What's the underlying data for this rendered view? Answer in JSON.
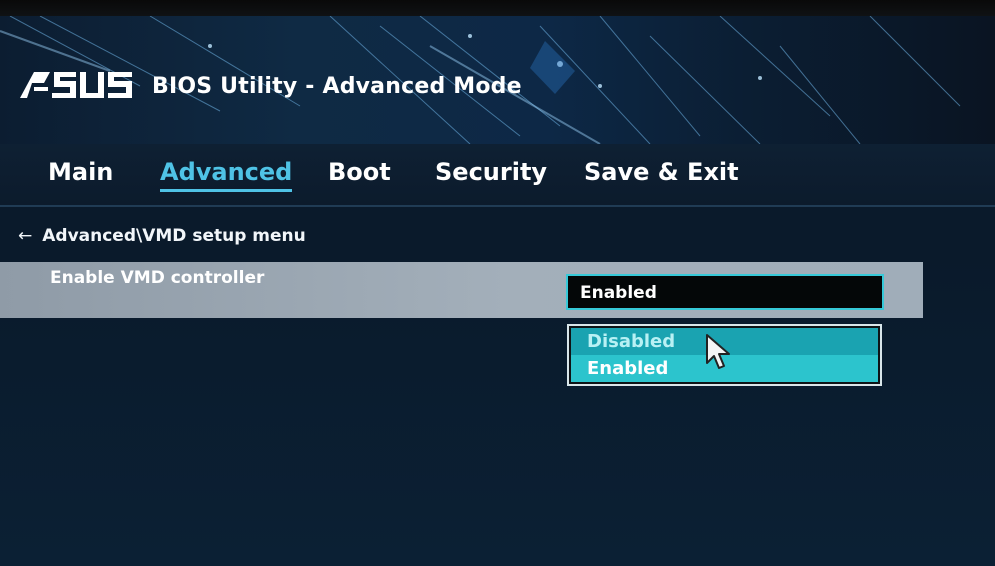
{
  "header": {
    "brand": "ASUS",
    "title": "BIOS Utility - Advanced Mode"
  },
  "tabs": [
    {
      "label": "Main",
      "active": false
    },
    {
      "label": "Advanced",
      "active": true
    },
    {
      "label": "Boot",
      "active": false
    },
    {
      "label": "Security",
      "active": false
    },
    {
      "label": "Save & Exit",
      "active": false
    }
  ],
  "breadcrumb": {
    "back_icon": "arrow-left-icon",
    "path": "Advanced\\VMD setup menu"
  },
  "setting": {
    "label": "Enable VMD controller",
    "value": "Enabled"
  },
  "dropdown": {
    "options": [
      "Disabled",
      "Enabled"
    ],
    "highlighted": "Enabled"
  },
  "colors": {
    "accent": "#4fc3e6",
    "option_highlight": "#2cc4cd",
    "row_highlight": "#a3afba"
  }
}
